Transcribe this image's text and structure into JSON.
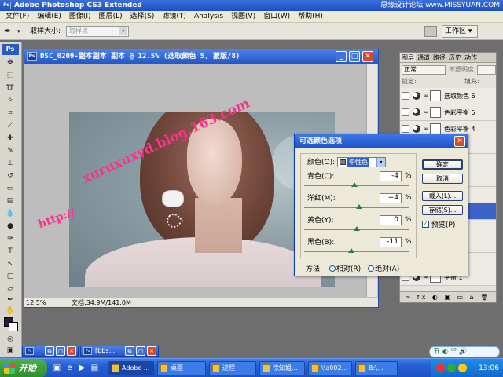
{
  "app": {
    "title": "Adobe Photoshop CS3 Extended",
    "logo": "Ps",
    "forum_watermark": "思缘设计论坛 www.MISSYUAN.COM"
  },
  "menu": [
    "文件(F)",
    "编辑(E)",
    "图像(I)",
    "图层(L)",
    "选择(S)",
    "滤镜(T)",
    "Analysis",
    "视图(V)",
    "窗口(W)",
    "帮助(H)"
  ],
  "options": {
    "tool_icon": "eyedropper-icon",
    "sample_label": "取样大小:",
    "sample_value": "取样点",
    "workspace_label": "工作区 ▾"
  },
  "tools": {
    "badge": "Ps",
    "fg_color": "#241c3c",
    "bg_color": "#ffffff"
  },
  "document": {
    "title": "DSC_0209-副本副本 副本 @ 12.5% (选取颜色 5, 蒙版/8)",
    "zoom": "12.5%",
    "doc_size": "文档:34.9M/141.0M",
    "watermark_1": "xuruxuxyd.blog.163.com",
    "watermark_2": "http://"
  },
  "layers": {
    "tabs": [
      "图层",
      "通道",
      "路径",
      "历史",
      "动作"
    ],
    "blend_mode": "正常",
    "opacity_label": "不透明度:",
    "lock_label": "锁定:",
    "fill_label": "填充:",
    "items": [
      {
        "name": "选取颜色 6",
        "selected": false
      },
      {
        "name": "色彩平衡 5",
        "selected": false
      },
      {
        "name": "色彩平衡 4",
        "selected": false
      },
      {
        "name": "填充 1",
        "selected": false
      },
      {
        "name": "滤镜 1",
        "selected": false
      },
      {
        "name": "映射 1",
        "selected": false
      },
      {
        "name": "平衡 3",
        "selected": false
      },
      {
        "name": "颜色 5",
        "selected": true
      },
      {
        "name": "平衡 2",
        "selected": false
      },
      {
        "name": "饱和...",
        "selected": false
      },
      {
        "name": "平衡 4",
        "selected": false
      },
      {
        "name": "平衡 1",
        "selected": false
      }
    ],
    "footer": "∞ fx ◐ ▣ ▭ ⌂ 🗑"
  },
  "dialog": {
    "title": "可选颜色选项",
    "color_label": "颜色(O):",
    "color_value": "中性色",
    "sliders": [
      {
        "label": "青色(C):",
        "value": "-4",
        "pct": -4
      },
      {
        "label": "洋红(M):",
        "value": "+4",
        "pct": 4
      },
      {
        "label": "黄色(Y):",
        "value": "0",
        "pct": 0
      },
      {
        "label": "黑色(B):",
        "value": "-11",
        "pct": -11
      }
    ],
    "percent_sign": "%",
    "buttons": {
      "ok": "确定",
      "cancel": "取消",
      "load": "载入(L)...",
      "save": "存储(S)..."
    },
    "preview_label": "预览(P)",
    "method_label": "方法:",
    "method_relative": "相对(R)",
    "method_absolute": "绝对(A)"
  },
  "minimized": [
    {
      "title": ""
    },
    {
      "title": "[bbs..."
    }
  ],
  "taskbar": {
    "start": "开始",
    "tasks": [
      {
        "label": "Adobe ...",
        "active": true
      },
      {
        "label": "桌面",
        "active": false
      },
      {
        "label": "进程",
        "active": false
      },
      {
        "label": "徐知姐...",
        "active": false
      },
      {
        "label": "\\\\a002...",
        "active": false
      },
      {
        "label": "B:\\...",
        "active": false
      }
    ],
    "ime": "五 ◐ ⁰⁰ 🔊",
    "clock": "13:06"
  }
}
